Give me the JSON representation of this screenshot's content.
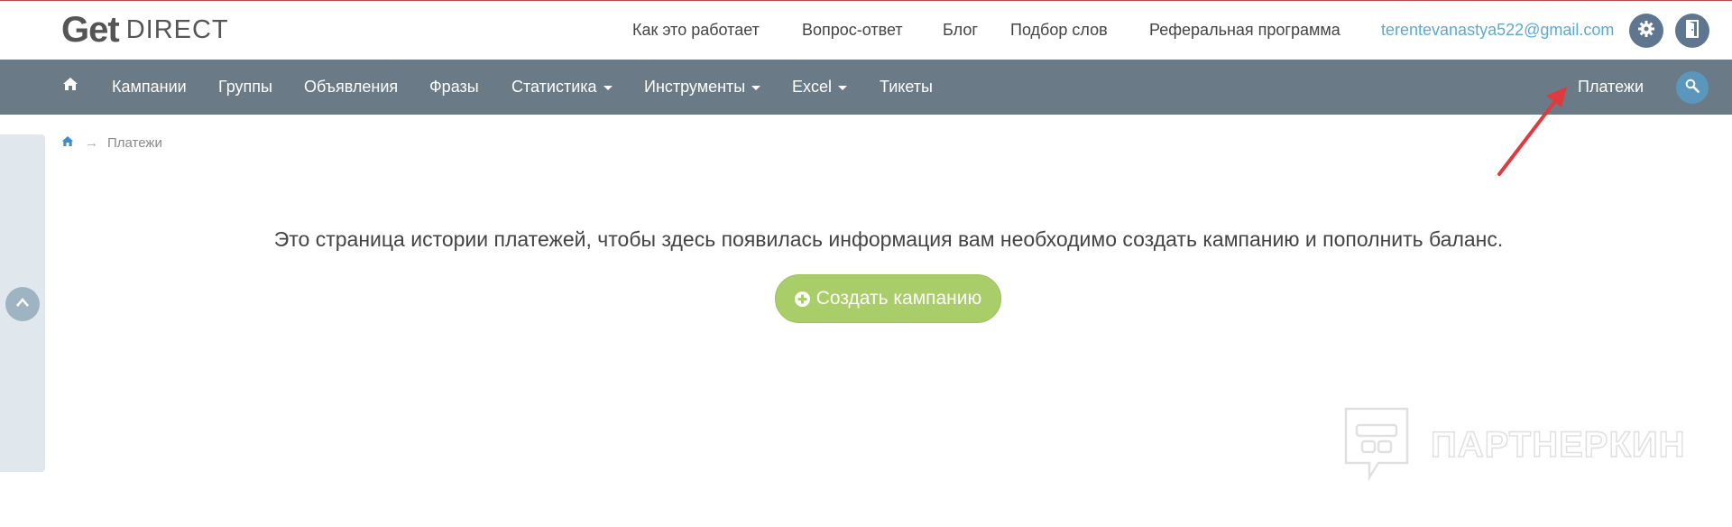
{
  "app": {
    "logo_get": "Get",
    "logo_direct": "DIRECT"
  },
  "header": {
    "links": [
      {
        "label": "Как это работает"
      },
      {
        "label": "Вопрос-ответ"
      },
      {
        "label": "Блог"
      },
      {
        "label": "Подбор слов"
      },
      {
        "label": "Реферальная программа"
      }
    ],
    "email": "terentevanastya522@gmail.com",
    "settings_icon": "gear-icon",
    "logout_icon": "door-exit-icon"
  },
  "nav": {
    "home_icon": "home-icon",
    "items": [
      {
        "label": "Кампании"
      },
      {
        "label": "Группы"
      },
      {
        "label": "Объявления"
      },
      {
        "label": "Фразы"
      },
      {
        "label": "Статистика"
      },
      {
        "label": "Инструменты"
      },
      {
        "label": "Excel"
      },
      {
        "label": "Тикеты"
      }
    ],
    "payments": "Платежи",
    "search_icon": "search-icon"
  },
  "breadcrumb": {
    "home_icon": "home-icon",
    "separator": "→",
    "current": "Платежи"
  },
  "main": {
    "message": "Это страница истории платежей, чтобы здесь появилась информация вам необходимо создать кампанию и пополнить баланс.",
    "create_button": "Создать кампанию",
    "create_icon": "plus-circle-icon"
  },
  "watermark": {
    "text": "ПАРТНЕРКИН"
  },
  "colors": {
    "navbar": "#6a7b87",
    "create_button": "#a9cd68",
    "email": "#5aaad6",
    "arrow": "#e0393e"
  }
}
